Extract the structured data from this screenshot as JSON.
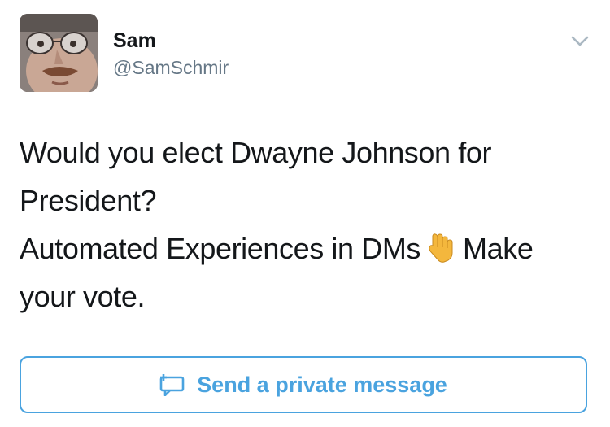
{
  "tweet": {
    "author": {
      "display_name": "Sam",
      "handle": "@SamSchmir",
      "avatar_icon": "profile-photo"
    },
    "caret_icon": "chevron-down-icon",
    "text_line_1": "Would you elect Dwayne Johnson for President?",
    "text_line_2_before": "Automated Experiences in DMs",
    "emoji_icon": "backhand-index-pointing-down-emoji",
    "text_line_2_after": "Make your vote.",
    "cta": {
      "label": "Send a private message",
      "icon": "direct-message-icon",
      "color": "#4aa3df"
    }
  }
}
